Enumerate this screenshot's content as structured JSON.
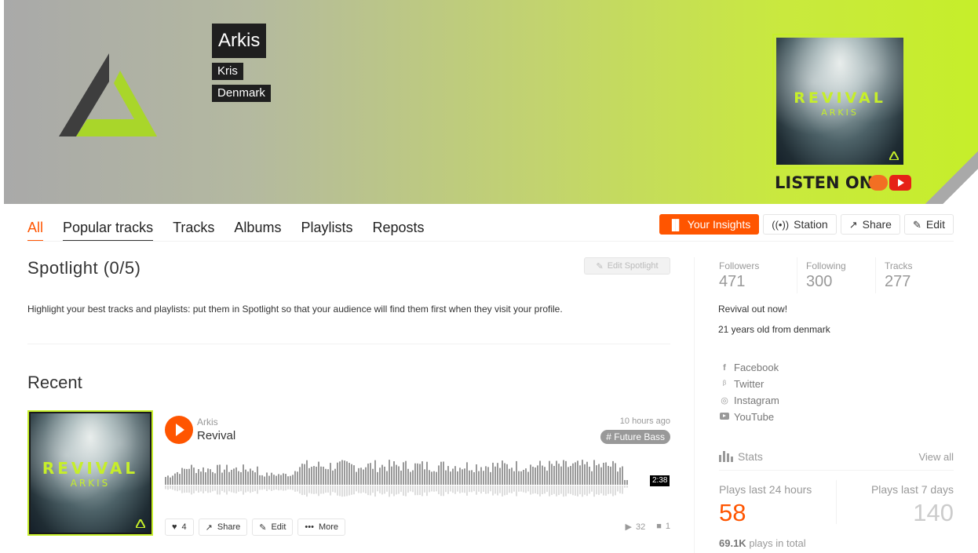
{
  "profile": {
    "name": "Arkis",
    "real_name": "Kris",
    "location": "Denmark",
    "accent_color": "#f50",
    "banner_color": "#c6ee2a"
  },
  "banner_art": {
    "title": "REVIVAL",
    "subtitle": "ARKIS",
    "listen_on": "LISTEN ON"
  },
  "tabs": [
    {
      "label": "All"
    },
    {
      "label": "Popular tracks"
    },
    {
      "label": "Tracks"
    },
    {
      "label": "Albums"
    },
    {
      "label": "Playlists"
    },
    {
      "label": "Reposts"
    }
  ],
  "actions": {
    "insights": "Your Insights",
    "station": "Station",
    "share": "Share",
    "edit": "Edit"
  },
  "spotlight": {
    "title": "Spotlight (0/5)",
    "edit_label": "Edit Spotlight",
    "description": "Highlight your best tracks and playlists: put them in Spotlight so that your audience will find them first when they visit your profile."
  },
  "recent": {
    "title": "Recent",
    "track": {
      "artist": "Arkis",
      "title": "Revival",
      "posted": "10 hours ago",
      "tag": "# Future Bass",
      "duration": "2:38",
      "art_title": "REVIVAL",
      "art_subtitle": "ARKIS",
      "likes": "4",
      "share_label": "Share",
      "edit_label": "Edit",
      "more_label": "More",
      "plays": "32",
      "comments": "1"
    }
  },
  "sidebar": {
    "followers_label": "Followers",
    "followers": "471",
    "following_label": "Following",
    "following": "300",
    "tracks_label": "Tracks",
    "tracks": "277",
    "bio_line1": "Revival out now!",
    "bio_line2": "21 years old from denmark",
    "links": [
      {
        "label": "Facebook",
        "icon": "facebook-icon"
      },
      {
        "label": "Twitter",
        "icon": "twitter-icon"
      },
      {
        "label": "Instagram",
        "icon": "instagram-icon"
      },
      {
        "label": "YouTube",
        "icon": "youtube-icon"
      }
    ],
    "stats_label": "Stats",
    "view_all": "View all",
    "plays_24_label": "Plays last 24 hours",
    "plays_24": "58",
    "plays_7_label": "Plays last 7 days",
    "plays_7": "140",
    "total_value": "69.1K",
    "total_suffix": " plays in total"
  }
}
